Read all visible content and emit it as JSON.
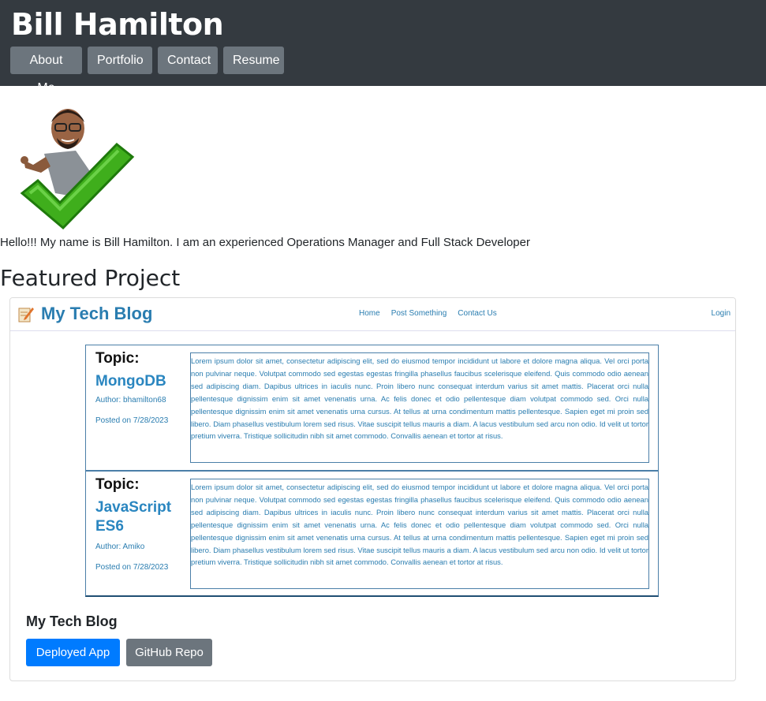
{
  "header": {
    "title": "Bill Hamilton",
    "nav": [
      "About Me",
      "Portfolio",
      "Contact",
      "Resume"
    ]
  },
  "about": {
    "avatar_icon": "bitmoji-thumbs-up-checkmark-icon",
    "intro": "Hello!!! My name is Bill Hamilton. I am an experienced Operations Manager and Full Stack Developer"
  },
  "featured": {
    "heading": "Featured Project",
    "screenshot": {
      "brand": "My Tech Blog",
      "logo_icon": "pencil-notepad-icon",
      "links": [
        "Home",
        "Post Something",
        "Contact Us"
      ],
      "login": "Login",
      "posts": [
        {
          "topic": "Topic:",
          "title": "MongoDB",
          "author": "Author: bhamilton68",
          "date": "Posted on 7/28/2023",
          "body": "Lorem ipsum dolor sit amet, consectetur adipiscing elit, sed do eiusmod tempor incididunt ut labore et dolore magna aliqua. Vel orci porta non pulvinar neque. Volutpat commodo sed egestas egestas fringilla phasellus faucibus scelerisque eleifend. Quis commodo odio aenean sed adipiscing diam. Dapibus ultrices in iaculis nunc. Proin libero nunc consequat interdum varius sit amet mattis. Placerat orci nulla pellentesque dignissim enim sit amet venenatis urna. Ac felis donec et odio pellentesque diam volutpat commodo sed. Orci nulla pellentesque dignissim enim sit amet venenatis urna cursus. At tellus at urna condimentum mattis pellentesque. Sapien eget mi proin sed libero. Diam phasellus vestibulum lorem sed risus. Vitae suscipit tellus mauris a diam. A lacus vestibulum sed arcu non odio. Id velit ut tortor pretium viverra. Tristique sollicitudin nibh sit amet commodo. Convallis aenean et tortor at risus."
        },
        {
          "topic": "Topic:",
          "title": "JavaScript ES6",
          "author": "Author: Amiko",
          "date": "Posted on 7/28/2023",
          "body": "Lorem ipsum dolor sit amet, consectetur adipiscing elit, sed do eiusmod tempor incididunt ut labore et dolore magna aliqua. Vel orci porta non pulvinar neque. Volutpat commodo sed egestas egestas fringilla phasellus faucibus scelerisque eleifend. Quis commodo odio aenean sed adipiscing diam. Dapibus ultrices in iaculis nunc. Proin libero nunc consequat interdum varius sit amet mattis. Placerat orci nulla pellentesque dignissim enim sit amet venenatis urna. Ac felis donec et odio pellentesque diam volutpat commodo sed. Orci nulla pellentesque dignissim enim sit amet venenatis urna cursus. At tellus at urna condimentum mattis pellentesque. Sapien eget mi proin sed libero. Diam phasellus vestibulum lorem sed risus. Vitae suscipit tellus mauris a diam. A lacus vestibulum sed arcu non odio. Id velit ut tortor pretium viverra. Tristique sollicitudin nibh sit amet commodo. Convallis aenean et tortor at risus."
        }
      ]
    },
    "project_name": "My Tech Blog",
    "deployed_label": "Deployed App",
    "repo_label": "GitHub Repo"
  },
  "colors": {
    "header_bg": "#343a40",
    "nav_button": "#6c757d",
    "primary": "#007bff",
    "blog_accent": "#2a7db0"
  }
}
